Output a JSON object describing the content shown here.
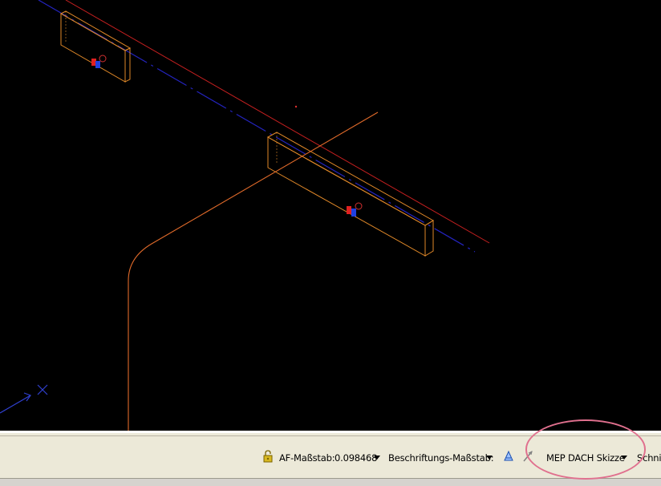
{
  "statusbar": {
    "af_scale_label": "AF-Maßstab:",
    "af_scale_value": "0.098468",
    "annotation_scale_label": "Beschriftungs-Maßstab:",
    "display_config": "MEP DACH Skizze",
    "section_label": "Schnit"
  },
  "icons": {
    "lock": "lock-icon",
    "annotation_visibility": "annotation-visibility-icon",
    "annotation_autoscale": "annotation-autoscale-icon",
    "ucs": "ucs-icon"
  },
  "colors": {
    "background": "#000000",
    "red_line": "#c82020",
    "blue_line": "#2020c8",
    "orange": "#e07820",
    "highlight": "#e0708e"
  }
}
